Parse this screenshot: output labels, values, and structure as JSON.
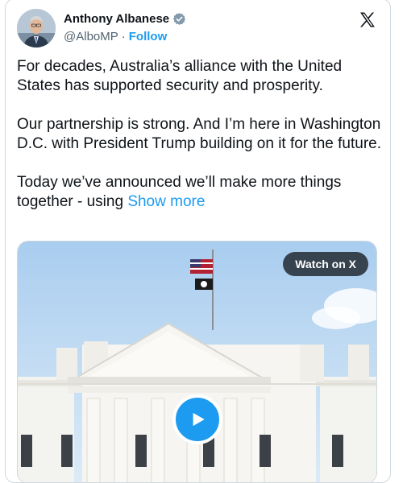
{
  "author": {
    "name": "Anthony Albanese",
    "handle": "@AlboMP",
    "separator": "·",
    "follow_label": "Follow",
    "verified": true
  },
  "icons": {
    "verified": "verified-badge-icon",
    "platform": "x-logo-icon",
    "play": "play-icon"
  },
  "post": {
    "paragraph1": "For decades, Australia’s alliance with the United States has supported security and prosperity.",
    "paragraph2": "Our partnership is strong. And I’m here in Washington D.C. with President Trump building on it for the future.",
    "paragraph3": "Today we’ve announced we’ll make more things together - using",
    "show_more": "Show more"
  },
  "media": {
    "watch_label": "Watch on X"
  },
  "colors": {
    "accent": "#1d9bf0",
    "text": "#0f1419",
    "muted": "#536471",
    "border": "#cfd9de"
  }
}
